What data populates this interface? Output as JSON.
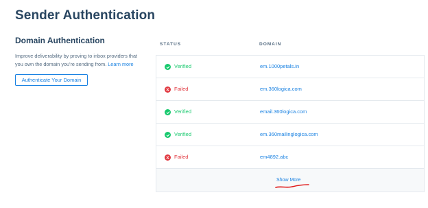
{
  "page": {
    "title": "Sender Authentication"
  },
  "domain_auth": {
    "title": "Domain Authentication",
    "description": "Improve deliverability by proving to inbox providers that you own the domain you're sending from.",
    "learn_more": "Learn more",
    "button_label": "Authenticate Your Domain"
  },
  "table": {
    "headers": {
      "status": "STATUS",
      "domain": "DOMAIN"
    },
    "rows": [
      {
        "status": "Verified",
        "state": "ok",
        "domain": "em.1000petals.in"
      },
      {
        "status": "Failed",
        "state": "fail",
        "domain": "em.360logica.com"
      },
      {
        "status": "Verified",
        "state": "ok",
        "domain": "email.360logica.com"
      },
      {
        "status": "Verified",
        "state": "ok",
        "domain": "em.360mailinglogica.com"
      },
      {
        "status": "Failed",
        "state": "fail",
        "domain": "em4892.abc"
      }
    ],
    "show_more": "Show More"
  },
  "colors": {
    "accent": "#1a82e2",
    "success": "#18c96e",
    "error": "#e1373f",
    "heading": "#294661",
    "annotation": "#e01919"
  },
  "icons": {
    "verified": "check-circle-icon",
    "failed": "x-circle-icon"
  }
}
